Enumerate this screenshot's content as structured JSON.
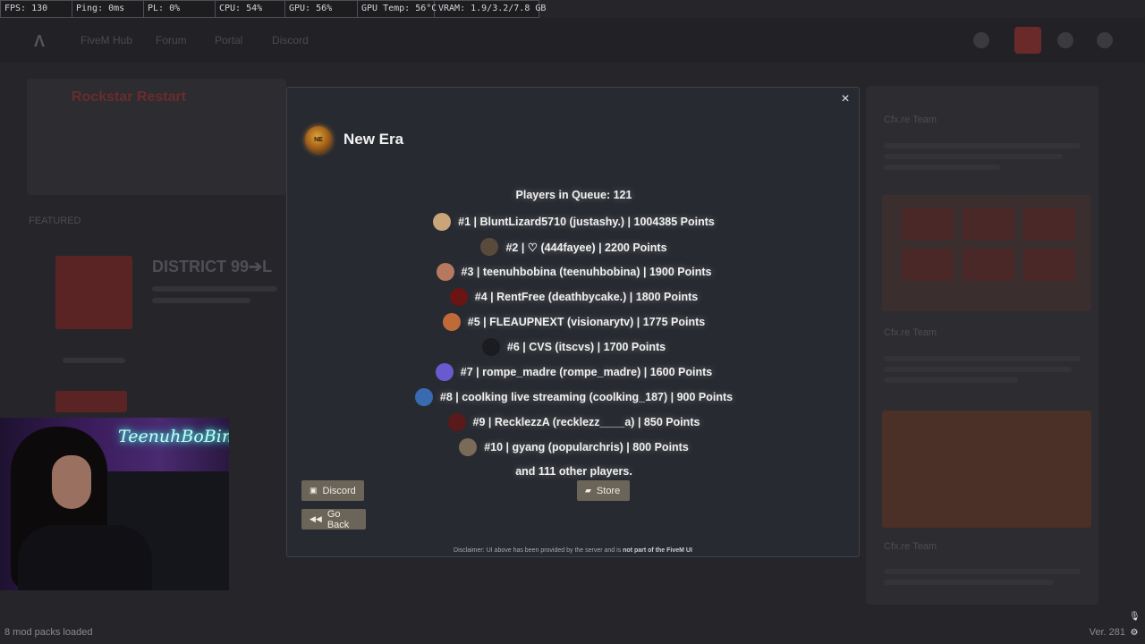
{
  "perf_overlay": [
    "FPS: 130",
    "Ping: 0ms",
    "PL: 0%",
    "CPU: 54%",
    "GPU: 56%",
    "GPU Temp: 56°C",
    "VRAM: 1.9/3.2/7.8 GB"
  ],
  "background": {
    "nav": [
      "FiveM Hub",
      "Forum",
      "Portal",
      "Discord"
    ],
    "section_title": "Rockstar Restart",
    "featured_label": "FEATURED",
    "server_title": "DISTRICT 99➔L",
    "news_author": "Cfx.re Team"
  },
  "modal": {
    "close_symbol": "×",
    "server_name": "New Era",
    "server_logo_text": "NE",
    "queue_count": "Players in Queue: 121",
    "players": [
      {
        "text": "#1 | BluntLizard5710 (justashy.) | 1004385 Points",
        "avatar_color": "#c9a67a"
      },
      {
        "text": "#2 | ♡ (444fayee) | 2200 Points",
        "avatar_color": "#5a4a3c"
      },
      {
        "text": "#3 | teenuhbobina (teenuhbobina) | 1900 Points",
        "avatar_color": "#b77860"
      },
      {
        "text": "#4 | RentFree (deathbycake.) | 1800 Points",
        "avatar_color": "#6a1414"
      },
      {
        "text": "#5 | FLEAUPNEXT (visionarytv) | 1775 Points",
        "avatar_color": "#c06a3a"
      },
      {
        "text": "#6 | CVS (itscvs) | 1700 Points",
        "avatar_color": "#1a1c20"
      },
      {
        "text": "#7 | rompe_madre (rompe_madre) | 1600 Points",
        "avatar_color": "#6a5ad0"
      },
      {
        "text": "#8 | coolking live streaming (coolking_187) | 900 Points",
        "avatar_color": "#3a6ab0"
      },
      {
        "text": "#9 | RecklezzA (recklezz____a) | 850 Points",
        "avatar_color": "#5a1a1a"
      },
      {
        "text": "#10 | gyang (popularchris) | 800 Points",
        "avatar_color": "#7a6a58"
      }
    ],
    "others": "and 111 other players.",
    "discord_label": "Discord",
    "store_label": "Store",
    "goback_label": "Go Back",
    "disclaimer_prefix": "Disclaimer: UI above has been provided by the server and is ",
    "disclaimer_bold": "not part of the FiveM UI"
  },
  "webcam": {
    "neon_text": "TeenuhBoBina"
  },
  "status": {
    "mods": "8 mod packs loaded",
    "version": "Ver. 281"
  },
  "icons": {
    "mic": "mic-icon",
    "settings": "gear-icon"
  }
}
